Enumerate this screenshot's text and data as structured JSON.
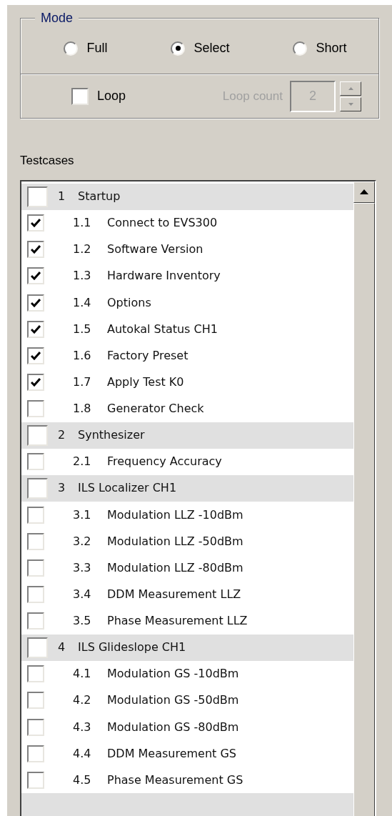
{
  "mode": {
    "legend": "Mode",
    "options": [
      {
        "label": "Full",
        "selected": false
      },
      {
        "label": "Select",
        "selected": true
      },
      {
        "label": "Short",
        "selected": false
      }
    ]
  },
  "loop": {
    "label": "Loop",
    "checked": false
  },
  "loop_count": {
    "label": "Loop count",
    "value": "2",
    "disabled": true
  },
  "testcases": {
    "label": "Testcases",
    "groups": [
      {
        "number": "1",
        "title": "Startup",
        "checked": false,
        "children": [
          {
            "number": "1.1",
            "title": "Connect to EVS300",
            "checked": true
          },
          {
            "number": "1.2",
            "title": "Software Version",
            "checked": true
          },
          {
            "number": "1.3",
            "title": "Hardware Inventory",
            "checked": true
          },
          {
            "number": "1.4",
            "title": "Options",
            "checked": true
          },
          {
            "number": "1.5",
            "title": "Autokal Status CH1",
            "checked": true
          },
          {
            "number": "1.6",
            "title": "Factory Preset",
            "checked": true
          },
          {
            "number": "1.7",
            "title": "Apply Test K0",
            "checked": true
          },
          {
            "number": "1.8",
            "title": "Generator Check",
            "checked": false
          }
        ]
      },
      {
        "number": "2",
        "title": "Synthesizer",
        "checked": false,
        "children": [
          {
            "number": "2.1",
            "title": "Frequency Accuracy",
            "checked": false
          }
        ]
      },
      {
        "number": "3",
        "title": "ILS Localizer CH1",
        "checked": false,
        "children": [
          {
            "number": "3.1",
            "title": "Modulation LLZ -10dBm",
            "checked": false
          },
          {
            "number": "3.2",
            "title": "Modulation LLZ -50dBm",
            "checked": false
          },
          {
            "number": "3.3",
            "title": "Modulation LLZ -80dBm",
            "checked": false
          },
          {
            "number": "3.4",
            "title": "DDM Measurement LLZ",
            "checked": false
          },
          {
            "number": "3.5",
            "title": "Phase Measurement LLZ",
            "checked": false
          }
        ]
      },
      {
        "number": "4",
        "title": "ILS Glideslope CH1",
        "checked": false,
        "children": [
          {
            "number": "4.1",
            "title": "Modulation GS -10dBm",
            "checked": false
          },
          {
            "number": "4.2",
            "title": "Modulation GS -50dBm",
            "checked": false
          },
          {
            "number": "4.3",
            "title": "Modulation GS -80dBm",
            "checked": false
          },
          {
            "number": "4.4",
            "title": "DDM Measurement GS",
            "checked": false
          },
          {
            "number": "4.5",
            "title": "Phase Measurement GS",
            "checked": false
          }
        ]
      }
    ]
  }
}
